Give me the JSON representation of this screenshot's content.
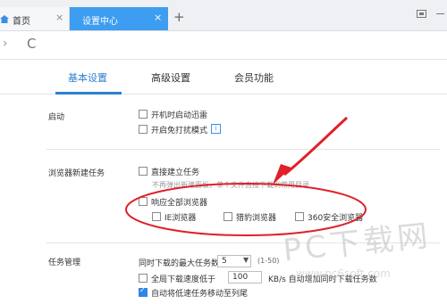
{
  "browser": {
    "tabs": [
      {
        "label": "首页"
      },
      {
        "label": "设置中心"
      }
    ],
    "new_tab": "+",
    "close": "×"
  },
  "nav": {
    "forward": "›",
    "reload": "C"
  },
  "settings_tabs": [
    "基本设置",
    "高级设置",
    "会员功能"
  ],
  "startup": {
    "section": "启动",
    "options": [
      "开机时启动迅雷",
      "开启免打扰模式"
    ]
  },
  "browser_task": {
    "section": "浏览器新建任务",
    "direct_label": "直接建立任务",
    "direct_sub": "不再弹出新建面板，单个文件直接下载到常用目录",
    "respond_all": "响应全部浏览器",
    "browsers": [
      "IE浏览器",
      "猎豹浏览器",
      "360安全浏览器"
    ]
  },
  "task_mgmt": {
    "section": "任务管理",
    "max_tasks_label": "同时下载的最大任务数",
    "max_tasks_value": "5",
    "max_tasks_range": "(1-50)",
    "speed_label": "全局下载速度低于",
    "speed_value": "100",
    "speed_unit": "KB/s 自动增加同时下载任务数",
    "auto_move": "自动将低速任务移动至列尾"
  },
  "watermark": {
    "big": "PC下载网",
    "small": "www.pc6soft.com"
  },
  "colors": {
    "accent": "#2c7fd1",
    "tab_active": "#3d9df0",
    "annotation": "#e0202a"
  }
}
